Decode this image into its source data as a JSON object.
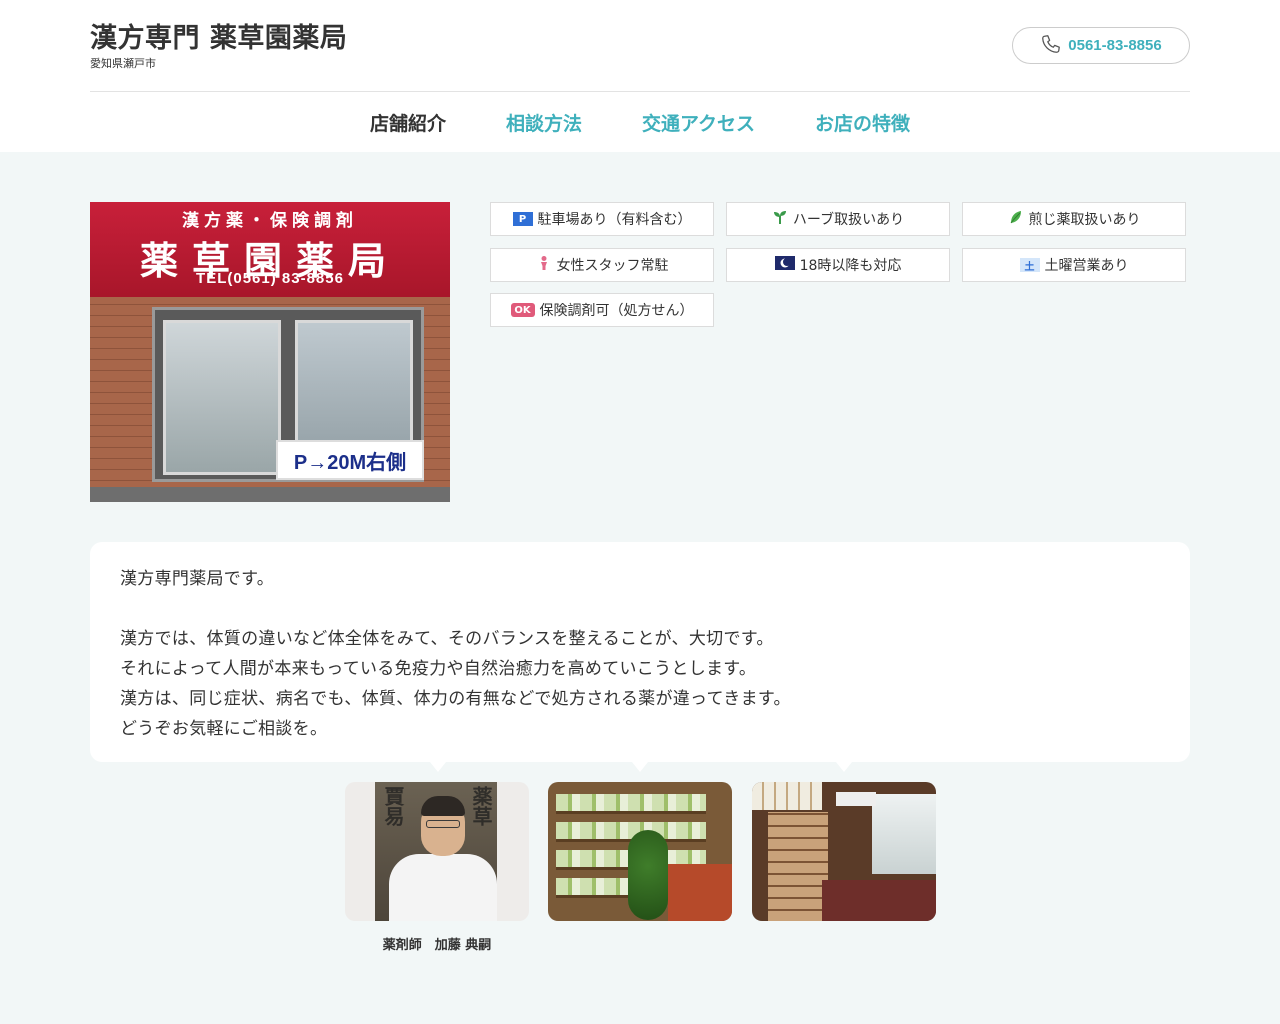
{
  "header": {
    "title": "漢方専門 薬草園薬局",
    "subtitle": "愛知県瀬戸市",
    "tel": "0561-83-8856"
  },
  "nav": {
    "items": [
      {
        "label": "店舗紹介"
      },
      {
        "label": "相談方法"
      },
      {
        "label": "交通アクセス"
      },
      {
        "label": "お店の特徴"
      }
    ]
  },
  "storefront": {
    "sign_top": "漢方薬・保険調剤",
    "sign_main": "薬草園薬局",
    "sign_tel": "TEL(0561) 83-8856",
    "parking_sign": "P→20M右側"
  },
  "features": [
    {
      "icon": "parking-icon",
      "icon_text": "P",
      "label": "駐車場あり（有料含む）"
    },
    {
      "icon": "sprout-icon",
      "label": "ハーブ取扱いあり"
    },
    {
      "icon": "leaf-icon",
      "label": "煎じ薬取扱いあり"
    },
    {
      "icon": "female-staff-icon",
      "label": "女性スタッフ常駐"
    },
    {
      "icon": "moon-icon",
      "label": "18時以降も対応"
    },
    {
      "icon": "saturday-icon",
      "icon_text": "土",
      "label": "土曜営業あり"
    },
    {
      "icon": "insurance-ok-icon",
      "icon_text": "OK",
      "label": "保険調剤可（処方せん）"
    }
  ],
  "intro": {
    "lines": [
      "漢方専門薬局です。",
      "",
      "漢方では、体質の違いなど体全体をみて、そのバランスを整えることが、大切です。",
      "それによって人間が本来もっている免疫力や自然治癒力を高めていこうとします。",
      "漢方は、同じ症状、病名でも、体質、体力の有無などで処方される薬が違ってきます。",
      "どうぞお気軽にご相談を。"
    ]
  },
  "gallery": {
    "caption": "薬剤師　加藤 典嗣"
  },
  "colors": {
    "accent": "#3fb0bc",
    "background": "#f2f7f7"
  }
}
